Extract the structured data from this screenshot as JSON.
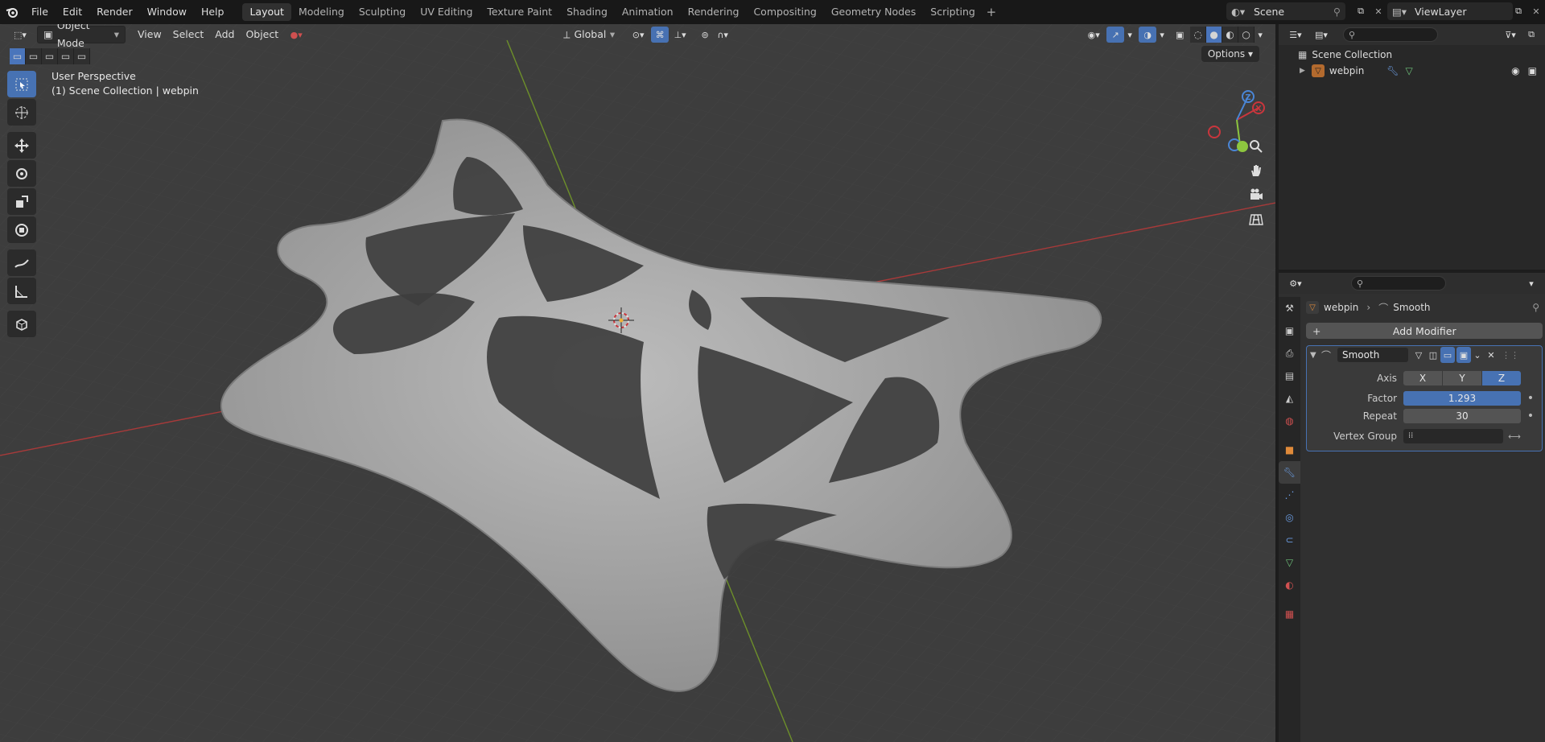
{
  "menu": {
    "items": [
      "File",
      "Edit",
      "Render",
      "Window",
      "Help"
    ]
  },
  "workspaces": {
    "tabs": [
      "Layout",
      "Modeling",
      "Sculpting",
      "UV Editing",
      "Texture Paint",
      "Shading",
      "Animation",
      "Rendering",
      "Compositing",
      "Geometry Nodes",
      "Scripting"
    ],
    "active": "Layout",
    "add": "+"
  },
  "scene": {
    "name": "Scene",
    "view_layer": "ViewLayer"
  },
  "viewport": {
    "mode": "Object Mode",
    "menus": [
      "View",
      "Select",
      "Add",
      "Object"
    ],
    "transform_orientation": "Global",
    "options_label": "Options",
    "overlay_line1": "User Perspective",
    "overlay_line2": "(1) Scene Collection | webpin",
    "gizmo": {
      "x": "X",
      "y": "Y",
      "z": "Z"
    }
  },
  "outliner": {
    "collection": "Scene Collection",
    "object": "webpin"
  },
  "properties": {
    "breadcrumb_object": "webpin",
    "breadcrumb_modifier": "Smooth",
    "add_modifier_label": "Add Modifier",
    "modifier": {
      "name": "Smooth",
      "axis_label": "Axis",
      "axes": [
        "X",
        "Y",
        "Z"
      ],
      "active_axis": "Z",
      "factor_label": "Factor",
      "factor": "1.293",
      "repeat_label": "Repeat",
      "repeat": "30",
      "vertex_group_label": "Vertex Group",
      "vertex_group": ""
    }
  },
  "colors": {
    "accent": "#4772b3",
    "x_axis": "#c9363d",
    "y_axis": "#8dc63f",
    "z_axis": "#4a86d6"
  }
}
